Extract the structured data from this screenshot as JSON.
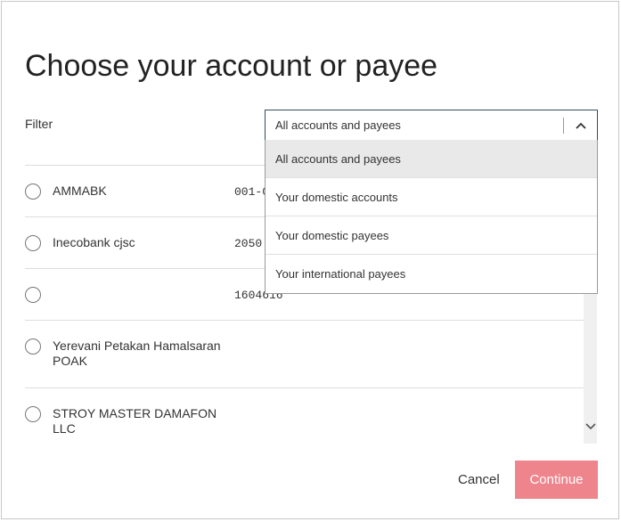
{
  "dialog": {
    "title": "Choose your account or payee",
    "filter_label": "Filter"
  },
  "filter_select": {
    "value": "All accounts and payees",
    "options": [
      "All accounts and payees",
      "Your domestic accounts",
      "Your domestic payees",
      "Your international payees"
    ],
    "selected_index": 0
  },
  "list": {
    "rows": [
      {
        "name": "AMMABK",
        "account": "001-0"
      },
      {
        "name": "Inecobank cjsc",
        "account": "2050"
      },
      {
        "name": "",
        "account": "1604616"
      },
      {
        "name": "Yerevani Petakan Hamalsaran POAK",
        "account": ""
      },
      {
        "name": "STROY MASTER DAMAFON LLC",
        "account": ""
      }
    ]
  },
  "actions": {
    "cancel_label": "Cancel",
    "continue_label": "Continue"
  },
  "colors": {
    "continue_bg": "#ef858c",
    "select_border": "#2d4f5a",
    "selected_option_bg": "#e9e9e9"
  },
  "icons": {
    "select_chevron": "chevron-up-icon",
    "scroll_down": "chevron-down-icon"
  }
}
